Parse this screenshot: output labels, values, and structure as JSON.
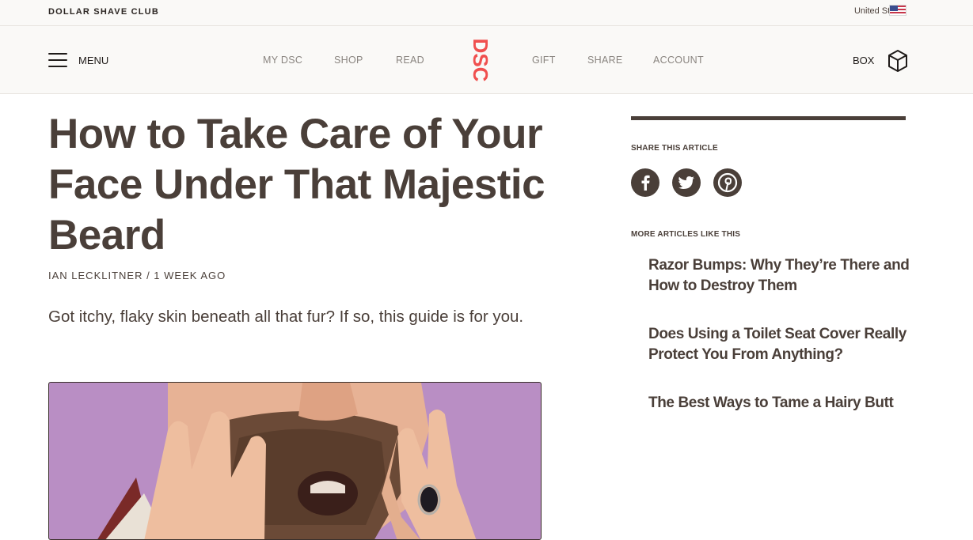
{
  "topbar": {
    "brand": "DOLLAR SHAVE CLUB",
    "locale": "United States",
    "flag_icon": "us-flag-icon"
  },
  "nav": {
    "menu_label": "MENU",
    "links": [
      "MY DSC",
      "SHOP",
      "READ",
      "GIFT",
      "SHARE",
      "ACCOUNT"
    ],
    "logo_text": "DSC",
    "box_label": "BOX",
    "colors": {
      "logo": "#f0504f",
      "text": "#8a8580",
      "bar_bg": "#faf9f7"
    }
  },
  "article": {
    "title": "How to Take Care of Your Face Under That Majestic Beard",
    "byline": "IAN LECKLITNER / 1 WEEK AGO",
    "dek": "Got itchy, flaky skin beneath all that fur? If so, this guide is for you.",
    "hero_bg": "#b98ec4"
  },
  "sidebar": {
    "share_heading": "SHARE THIS ARTICLE",
    "share_icons": [
      "facebook-icon",
      "twitter-icon",
      "pinterest-icon"
    ],
    "more_heading": "MORE ARTICLES LIKE THIS",
    "related": [
      "Razor Bumps: Why They’re There and How to Destroy Them",
      "Does Using a Toilet Seat Cover Really Protect You From Anything?",
      "The Best Ways to Tame a Hairy Butt"
    ],
    "colors": {
      "text": "#4a3f39"
    }
  }
}
